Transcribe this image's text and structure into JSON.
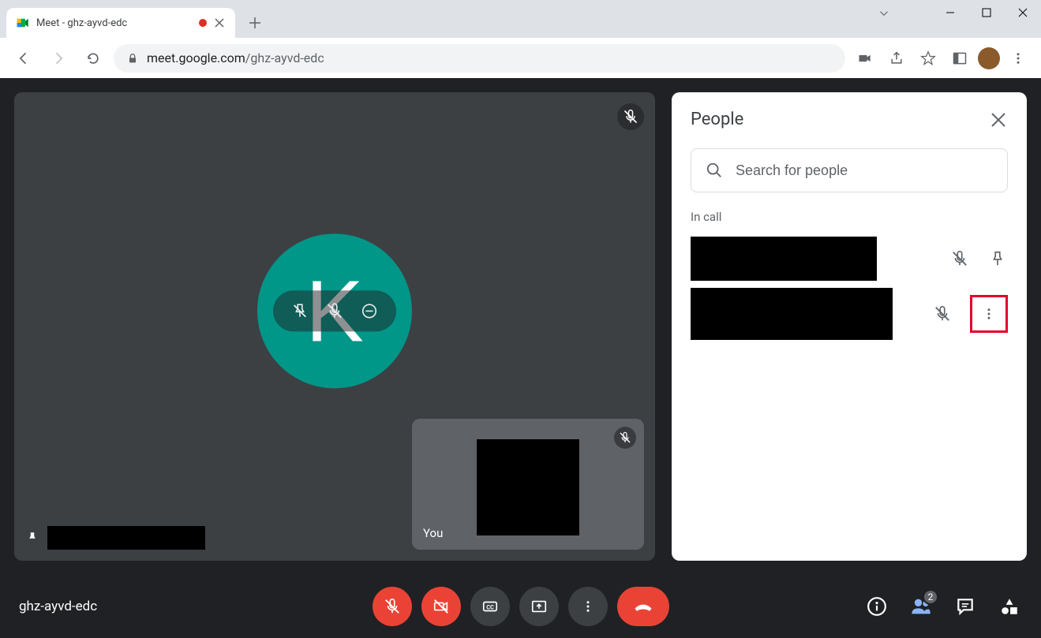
{
  "browser": {
    "tab_title": "Meet - ghz-ayvd-edc",
    "url_domain": "meet.google.com",
    "url_path": "/ghz-ayvd-edc"
  },
  "meet": {
    "main_avatar_letter": "K",
    "self_label": "You",
    "meeting_code": "ghz-ayvd-edc",
    "people_count": "2"
  },
  "panel": {
    "title": "People",
    "search_placeholder": "Search for people",
    "section_label": "In call"
  }
}
